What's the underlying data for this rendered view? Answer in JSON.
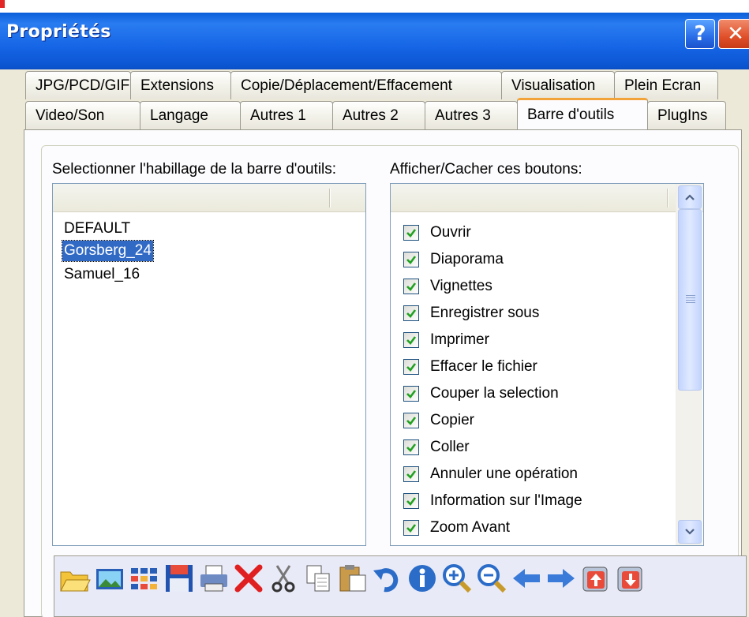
{
  "window": {
    "title": "Propriétés",
    "help_label": "?",
    "close_label": "✕"
  },
  "tabs_row1": [
    "JPG/PCD/GIF",
    "Extensions",
    "Copie/Déplacement/Effacement",
    "Visualisation",
    "Plein Ecran"
  ],
  "tabs_row2": [
    "Video/Son",
    "Langage",
    "Autres 1",
    "Autres 2",
    "Autres 3",
    "Barre d'outils",
    "PlugIns"
  ],
  "active_tab": "Barre d'outils",
  "skins": {
    "label": "Selectionner l'habillage de la barre d'outils:",
    "items": [
      "DEFAULT",
      "Gorsberg_24",
      "Samuel_16"
    ],
    "selected": "Gorsberg_24"
  },
  "buttons_list": {
    "label": "Afficher/Cacher ces boutons:",
    "items": [
      {
        "label": "Ouvrir",
        "checked": true
      },
      {
        "label": "Diaporama",
        "checked": true
      },
      {
        "label": "Vignettes",
        "checked": true
      },
      {
        "label": "Enregistrer sous",
        "checked": true
      },
      {
        "label": "Imprimer",
        "checked": true
      },
      {
        "label": "Effacer le fichier",
        "checked": true
      },
      {
        "label": "Couper la selection",
        "checked": true
      },
      {
        "label": "Copier",
        "checked": true
      },
      {
        "label": "Coller",
        "checked": true
      },
      {
        "label": "Annuler une opération",
        "checked": true
      },
      {
        "label": "Information sur l'Image",
        "checked": true
      },
      {
        "label": "Zoom Avant",
        "checked": true
      }
    ]
  },
  "toolbar_icons": [
    "open-folder-icon",
    "slideshow-icon",
    "thumbnails-icon",
    "save-as-icon",
    "print-icon",
    "delete-icon",
    "cut-icon",
    "copy-icon",
    "paste-icon",
    "undo-icon",
    "info-icon",
    "zoom-in-icon",
    "zoom-out-icon",
    "previous-arrow-icon",
    "next-arrow-icon",
    "first-page-icon",
    "last-page-icon"
  ],
  "colors": {
    "titlebar": "#1565e6",
    "selection": "#316ac5",
    "active_tab_accent": "#f2a33a",
    "check": "#21a121"
  }
}
